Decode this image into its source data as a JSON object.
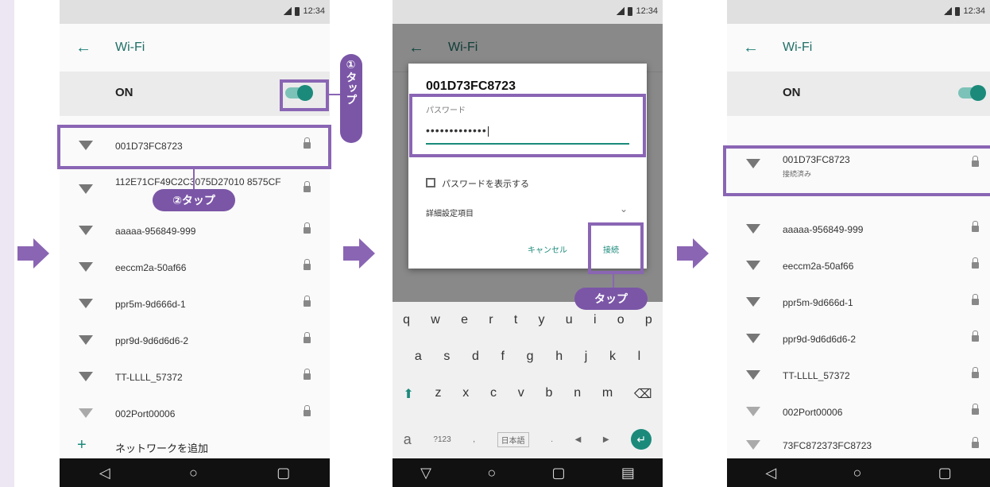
{
  "statusbar": {
    "time": "12:34"
  },
  "wifi_title": "Wi-Fi",
  "on_label": "ON",
  "phone1": {
    "networks": [
      {
        "name": "001D73FC8723"
      },
      {
        "name": "112E71CF49C2C3075D27010 8575CF"
      },
      {
        "name": "aaaaa-956849-999"
      },
      {
        "name": "eeccm2a-50af66"
      },
      {
        "name": "ppr5m-9d666d-1"
      },
      {
        "name": "ppr9d-9d6d6d6-2"
      },
      {
        "name": "TT-LLLL_57372"
      },
      {
        "name": "002Port00006"
      }
    ],
    "add_network": "ネットワークを追加",
    "annotation_1": "①タップ",
    "annotation_2": "②タップ"
  },
  "phone2": {
    "dialog_title": "001D73FC8723",
    "password_label": "パスワード",
    "password_value": "•••••••••••••|",
    "show_password": "パスワードを表示する",
    "advanced": "詳細設定項目",
    "cancel": "キャンセル",
    "connect": "接続",
    "annotation": "タップ",
    "keyboard_row1": [
      "q",
      "w",
      "e",
      "r",
      "t",
      "y",
      "u",
      "i",
      "o",
      "p"
    ],
    "keyboard_row2": [
      "a",
      "s",
      "d",
      "f",
      "g",
      "h",
      "j",
      "k",
      "l"
    ],
    "keyboard_row3": [
      "z",
      "x",
      "c",
      "v",
      "b",
      "n",
      "m"
    ],
    "keyboard_special": [
      "a",
      "?123",
      ",",
      "日本語",
      ".",
      "◀",
      "▶"
    ]
  },
  "phone3": {
    "networks": [
      {
        "name": "001D73FC8723",
        "status": "接続済み"
      },
      {
        "name": "aaaaa-956849-999"
      },
      {
        "name": "eeccm2a-50af66"
      },
      {
        "name": "ppr5m-9d666d-1"
      },
      {
        "name": "ppr9d-9d6d6d6-2"
      },
      {
        "name": "TT-LLLL_57372"
      },
      {
        "name": "002Port00006"
      },
      {
        "name": "73FC872373FC8723"
      }
    ]
  },
  "colors": {
    "accent": "#1b8a7b",
    "highlight": "#8a65b4",
    "badge": "#7b56a7"
  }
}
